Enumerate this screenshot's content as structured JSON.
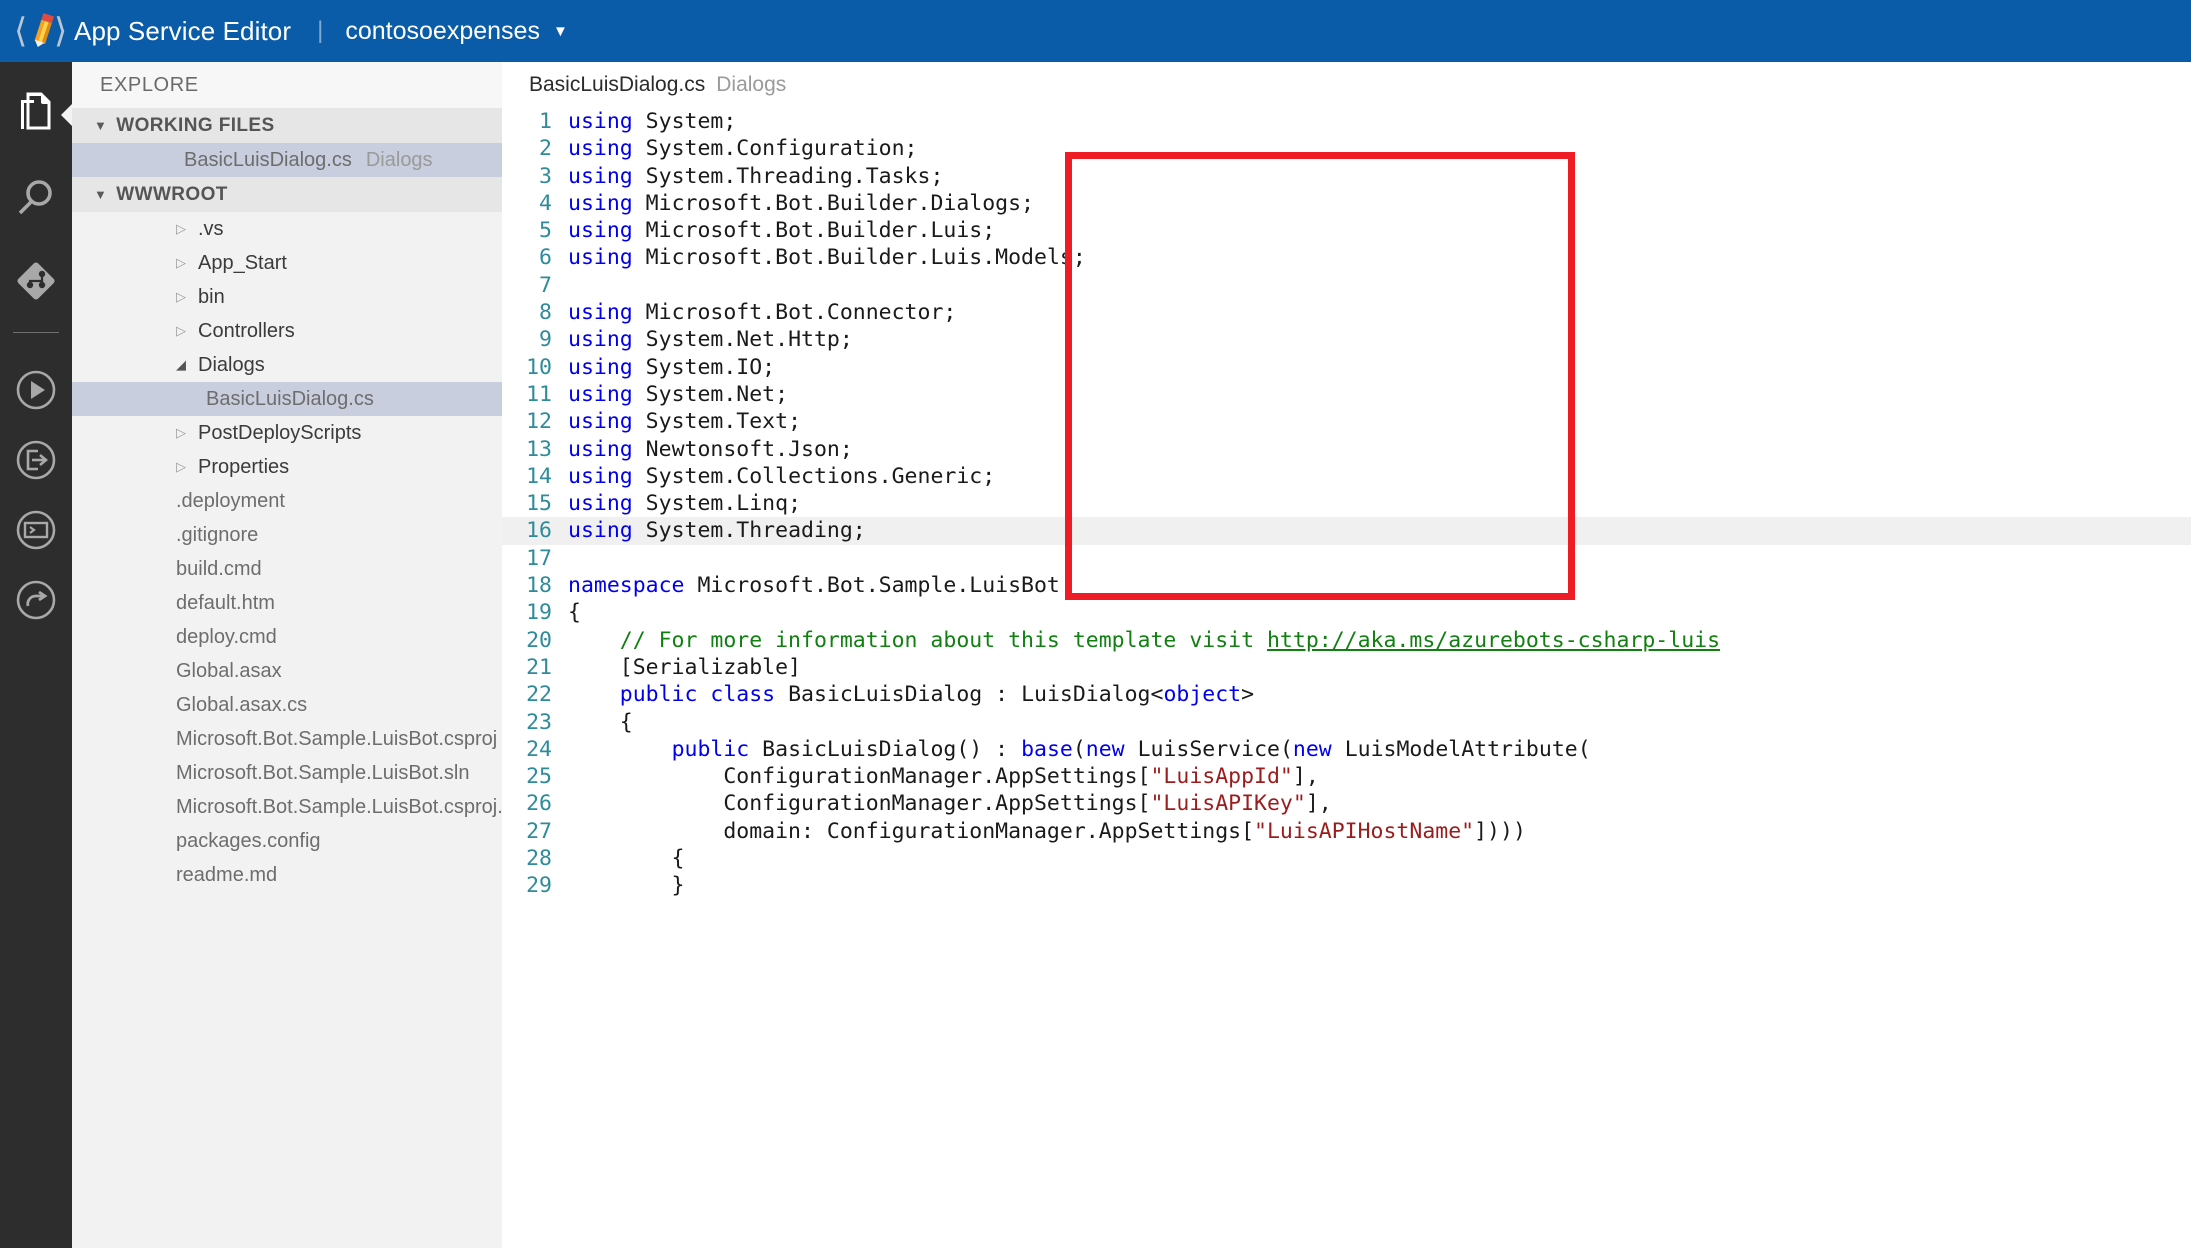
{
  "header": {
    "logo_icon": "app-service-editor-logo",
    "app_title": "App Service Editor",
    "separator": "|",
    "site_name": "contosoexpenses",
    "caret_icon": "▼",
    "brand_color": "#0a5ca8"
  },
  "activity_bar": {
    "items": [
      {
        "name": "explorer-files-icon",
        "active": true
      },
      {
        "name": "search-icon",
        "active": false
      },
      {
        "name": "source-control-git-icon",
        "active": false
      },
      {
        "name": "run-play-icon",
        "active": false
      },
      {
        "name": "open-in-new-window-icon",
        "active": false
      },
      {
        "name": "console-terminal-icon",
        "active": false
      },
      {
        "name": "restart-refresh-icon",
        "active": false
      }
    ]
  },
  "explorer": {
    "title": "EXPLORE",
    "working_files": {
      "label": "WORKING FILES",
      "expanded": true,
      "files": [
        {
          "name": "BasicLuisDialog.cs",
          "folder": "Dialogs",
          "selected": true
        }
      ]
    },
    "wwwroot": {
      "label": "WWWROOT",
      "expanded": true,
      "items": [
        {
          "label": ".vs",
          "type": "folder",
          "expanded": false,
          "indent": 1
        },
        {
          "label": "App_Start",
          "type": "folder",
          "expanded": false,
          "indent": 1
        },
        {
          "label": "bin",
          "type": "folder",
          "expanded": false,
          "indent": 1
        },
        {
          "label": "Controllers",
          "type": "folder",
          "expanded": false,
          "indent": 1
        },
        {
          "label": "Dialogs",
          "type": "folder",
          "expanded": true,
          "indent": 1
        },
        {
          "label": "BasicLuisDialog.cs",
          "type": "file",
          "selected": true,
          "indent": 2
        },
        {
          "label": "PostDeployScripts",
          "type": "folder",
          "expanded": false,
          "indent": 1
        },
        {
          "label": "Properties",
          "type": "folder",
          "expanded": false,
          "indent": 1
        },
        {
          "label": ".deployment",
          "type": "file",
          "indent": 1
        },
        {
          "label": ".gitignore",
          "type": "file",
          "indent": 1
        },
        {
          "label": "build.cmd",
          "type": "file",
          "indent": 1
        },
        {
          "label": "default.htm",
          "type": "file",
          "indent": 1
        },
        {
          "label": "deploy.cmd",
          "type": "file",
          "indent": 1
        },
        {
          "label": "Global.asax",
          "type": "file",
          "indent": 1
        },
        {
          "label": "Global.asax.cs",
          "type": "file",
          "indent": 1
        },
        {
          "label": "Microsoft.Bot.Sample.LuisBot.csproj",
          "type": "file",
          "indent": 1
        },
        {
          "label": "Microsoft.Bot.Sample.LuisBot.sln",
          "type": "file",
          "indent": 1
        },
        {
          "label": "Microsoft.Bot.Sample.LuisBot.csproj.user",
          "type": "file",
          "indent": 1
        },
        {
          "label": "packages.config",
          "type": "file",
          "indent": 1
        },
        {
          "label": "readme.md",
          "type": "file",
          "indent": 1
        }
      ]
    }
  },
  "editor": {
    "breadcrumb_file": "BasicLuisDialog.cs",
    "breadcrumb_path": "Dialogs",
    "current_line": 16,
    "annotation": {
      "shape": "rectangle",
      "color": "#ee1c25",
      "covers_lines": "1-16"
    },
    "lines": [
      {
        "n": 1,
        "tokens": [
          {
            "t": "kw",
            "v": "using"
          },
          {
            "t": "p",
            "v": " System;"
          }
        ]
      },
      {
        "n": 2,
        "tokens": [
          {
            "t": "kw",
            "v": "using"
          },
          {
            "t": "p",
            "v": " System.Configuration;"
          }
        ]
      },
      {
        "n": 3,
        "tokens": [
          {
            "t": "kw",
            "v": "using"
          },
          {
            "t": "p",
            "v": " System.Threading.Tasks;"
          }
        ]
      },
      {
        "n": 4,
        "tokens": [
          {
            "t": "kw",
            "v": "using"
          },
          {
            "t": "p",
            "v": " Microsoft.Bot.Builder.Dialogs;"
          }
        ]
      },
      {
        "n": 5,
        "tokens": [
          {
            "t": "kw",
            "v": "using"
          },
          {
            "t": "p",
            "v": " Microsoft.Bot.Builder.Luis;"
          }
        ]
      },
      {
        "n": 6,
        "tokens": [
          {
            "t": "kw",
            "v": "using"
          },
          {
            "t": "p",
            "v": " Microsoft.Bot.Builder.Luis.Models;"
          }
        ]
      },
      {
        "n": 7,
        "tokens": []
      },
      {
        "n": 8,
        "tokens": [
          {
            "t": "kw",
            "v": "using"
          },
          {
            "t": "p",
            "v": " Microsoft.Bot.Connector;"
          }
        ]
      },
      {
        "n": 9,
        "tokens": [
          {
            "t": "kw",
            "v": "using"
          },
          {
            "t": "p",
            "v": " System.Net.Http;"
          }
        ]
      },
      {
        "n": 10,
        "tokens": [
          {
            "t": "kw",
            "v": "using"
          },
          {
            "t": "p",
            "v": " System.IO;"
          }
        ]
      },
      {
        "n": 11,
        "tokens": [
          {
            "t": "kw",
            "v": "using"
          },
          {
            "t": "p",
            "v": " System.Net;"
          }
        ]
      },
      {
        "n": 12,
        "tokens": [
          {
            "t": "kw",
            "v": "using"
          },
          {
            "t": "p",
            "v": " System.Text;"
          }
        ]
      },
      {
        "n": 13,
        "tokens": [
          {
            "t": "kw",
            "v": "using"
          },
          {
            "t": "p",
            "v": " Newtonsoft.Json;"
          }
        ]
      },
      {
        "n": 14,
        "tokens": [
          {
            "t": "kw",
            "v": "using"
          },
          {
            "t": "p",
            "v": " System.Collections.Generic;"
          }
        ]
      },
      {
        "n": 15,
        "tokens": [
          {
            "t": "kw",
            "v": "using"
          },
          {
            "t": "p",
            "v": " System.Linq;"
          }
        ]
      },
      {
        "n": 16,
        "tokens": [
          {
            "t": "kw",
            "v": "using"
          },
          {
            "t": "p",
            "v": " System.Threading;"
          }
        ],
        "current": true
      },
      {
        "n": 17,
        "tokens": []
      },
      {
        "n": 18,
        "tokens": [
          {
            "t": "kw",
            "v": "namespace"
          },
          {
            "t": "p",
            "v": " Microsoft.Bot.Sample.LuisBot"
          }
        ]
      },
      {
        "n": 19,
        "tokens": [
          {
            "t": "p",
            "v": "{"
          }
        ]
      },
      {
        "n": 20,
        "tokens": [
          {
            "t": "cm",
            "v": "    // For more information about this template visit "
          },
          {
            "t": "lnk",
            "v": "http://aka.ms/azurebots-csharp-luis"
          }
        ]
      },
      {
        "n": 21,
        "tokens": [
          {
            "t": "p",
            "v": "    [Serializable]"
          }
        ]
      },
      {
        "n": 22,
        "tokens": [
          {
            "t": "p",
            "v": "    "
          },
          {
            "t": "kw",
            "v": "public class"
          },
          {
            "t": "p",
            "v": " BasicLuisDialog : LuisDialog<"
          },
          {
            "t": "kw",
            "v": "object"
          },
          {
            "t": "p",
            "v": ">"
          }
        ]
      },
      {
        "n": 23,
        "tokens": [
          {
            "t": "p",
            "v": "    {"
          }
        ]
      },
      {
        "n": 24,
        "tokens": [
          {
            "t": "p",
            "v": "        "
          },
          {
            "t": "kw",
            "v": "public"
          },
          {
            "t": "p",
            "v": " BasicLuisDialog() : "
          },
          {
            "t": "kw",
            "v": "base"
          },
          {
            "t": "p",
            "v": "("
          },
          {
            "t": "kw",
            "v": "new"
          },
          {
            "t": "p",
            "v": " LuisService("
          },
          {
            "t": "kw",
            "v": "new"
          },
          {
            "t": "p",
            "v": " LuisModelAttribute("
          }
        ]
      },
      {
        "n": 25,
        "tokens": [
          {
            "t": "p",
            "v": "            ConfigurationManager.AppSettings["
          },
          {
            "t": "str",
            "v": "\"LuisAppId\""
          },
          {
            "t": "p",
            "v": "],"
          }
        ]
      },
      {
        "n": 26,
        "tokens": [
          {
            "t": "p",
            "v": "            ConfigurationManager.AppSettings["
          },
          {
            "t": "str",
            "v": "\"LuisAPIKey\""
          },
          {
            "t": "p",
            "v": "],"
          }
        ]
      },
      {
        "n": 27,
        "tokens": [
          {
            "t": "p",
            "v": "            domain: ConfigurationManager.AppSettings["
          },
          {
            "t": "str",
            "v": "\"LuisAPIHostName\""
          },
          {
            "t": "p",
            "v": "])))"
          }
        ]
      },
      {
        "n": 28,
        "tokens": [
          {
            "t": "p",
            "v": "        {"
          }
        ]
      },
      {
        "n": 29,
        "tokens": [
          {
            "t": "p",
            "v": "        }"
          }
        ]
      }
    ]
  },
  "colors": {
    "keyword": "#0000ee",
    "comment": "#108010",
    "string": "#9b1c1c",
    "line_number": "#2e8b9a",
    "selection": "#c9cede",
    "annotation_red": "#ee1c25"
  }
}
